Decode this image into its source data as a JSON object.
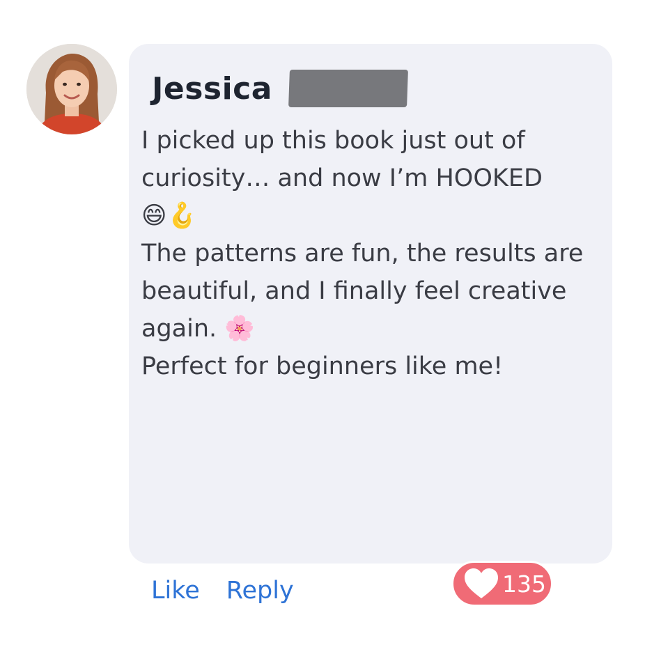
{
  "comment": {
    "author_name": "Jessica",
    "body_lines": "I picked up this book just out of\ncuriosity… and now I’m HOOKED\n😄🪝\nThe patterns are fun, the results are\nbeautiful, and I finally feel creative\nagain. 🌸\nPerfect for beginners like me!"
  },
  "actions": {
    "like_label": "Like",
    "reply_label": "Reply"
  },
  "reactions": {
    "icon": "heart-icon",
    "count": "135"
  },
  "colors": {
    "bubble": "#f0f1f7",
    "link": "#2e73d6",
    "reaction": "#f06b76",
    "name": "#1e2430",
    "body_text": "#3a3c44"
  }
}
